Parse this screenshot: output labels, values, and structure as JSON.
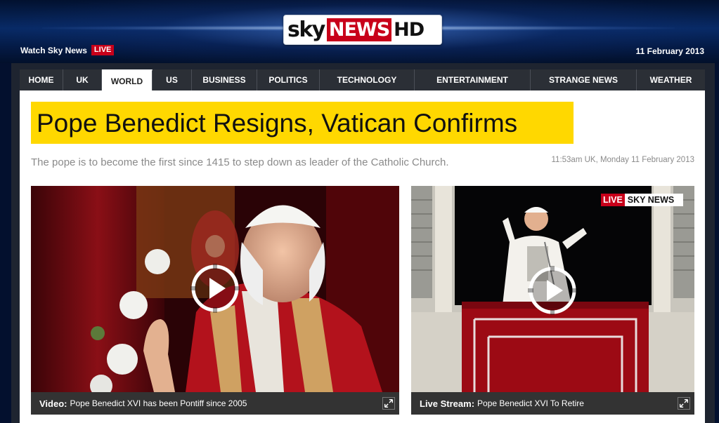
{
  "header": {
    "logo": {
      "sky": "sky",
      "news": "NEWS",
      "hd": "HD"
    },
    "watch_label": "Watch Sky News",
    "live_label": "LIVE",
    "date": "11 February 2013"
  },
  "nav": {
    "items": [
      {
        "label": "HOME",
        "active": false
      },
      {
        "label": "UK",
        "active": false
      },
      {
        "label": "WORLD",
        "active": true
      },
      {
        "label": "US",
        "active": false
      },
      {
        "label": "BUSINESS",
        "active": false
      },
      {
        "label": "POLITICS",
        "active": false
      },
      {
        "label": "TECHNOLOGY",
        "active": false
      },
      {
        "label": "ENTERTAINMENT",
        "active": false
      },
      {
        "label": "STRANGE NEWS",
        "active": false
      },
      {
        "label": "WEATHER",
        "active": false
      }
    ]
  },
  "article": {
    "headline": "Pope Benedict Resigns, Vatican Confirms",
    "standfirst": "The pope is to become the first since 1415 to step down as leader of the Catholic Church.",
    "timestamp": "11:53am UK, Monday 11 February 2013"
  },
  "media": {
    "left": {
      "caption_type": "Video:",
      "caption_text": "Pope Benedict XVI has been Pontiff since 2005"
    },
    "right": {
      "caption_type": "Live Stream:",
      "caption_text": "Pope Benedict XVI To Retire",
      "badge_live": "LIVE",
      "badge_brand": "SKY NEWS"
    }
  },
  "colors": {
    "brand_red": "#c8001a",
    "headline_yellow": "#ffd800",
    "nav_bg": "#2b2f36",
    "header_blue": "#082a66"
  },
  "icons": [
    "play-icon",
    "expand-icon"
  ]
}
